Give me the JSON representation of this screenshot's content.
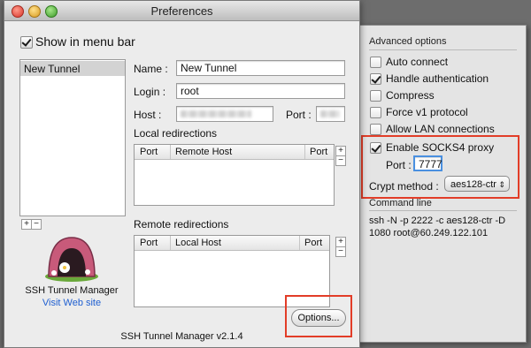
{
  "window": {
    "title": "Preferences",
    "show_in_menu_bar": "Show in menu bar",
    "version": "SSH Tunnel Manager v2.1.4"
  },
  "tunnels": {
    "items": [
      "New Tunnel"
    ]
  },
  "form": {
    "name_label": "Name :",
    "name_value": "New Tunnel",
    "login_label": "Login :",
    "login_value": "root",
    "host_label": "Host :",
    "port_label": "Port :"
  },
  "local_redirections": {
    "title": "Local redirections",
    "columns": [
      "Port",
      "Remote Host",
      "Port"
    ]
  },
  "remote_redirections": {
    "title": "Remote redirections",
    "columns": [
      "Port",
      "Local Host",
      "Port"
    ]
  },
  "app": {
    "name": "SSH Tunnel Manager",
    "link": "Visit Web site"
  },
  "buttons": {
    "options": "Options...",
    "add": "+",
    "remove": "−"
  },
  "advanced": {
    "title": "Advanced options",
    "options": [
      {
        "label": "Auto connect",
        "checked": false
      },
      {
        "label": "Handle authentication",
        "checked": true
      },
      {
        "label": "Compress",
        "checked": false
      },
      {
        "label": "Force v1 protocol",
        "checked": false
      },
      {
        "label": "Allow LAN connections",
        "checked": false
      },
      {
        "label": "Enable SOCKS4 proxy",
        "checked": true
      }
    ],
    "socks_port_label": "Port :",
    "socks_port_value": "7777",
    "crypt_label": "Crypt method :",
    "crypt_value": "aes128-ctr"
  },
  "command_line": {
    "title": "Command line",
    "text": "ssh -N -p 2222 -c aes128-ctr -D 1080 root@60.249.122.101"
  },
  "colors": {
    "highlight": "#e23d28",
    "link": "#1f5fd1",
    "focus": "#4a90e0"
  }
}
